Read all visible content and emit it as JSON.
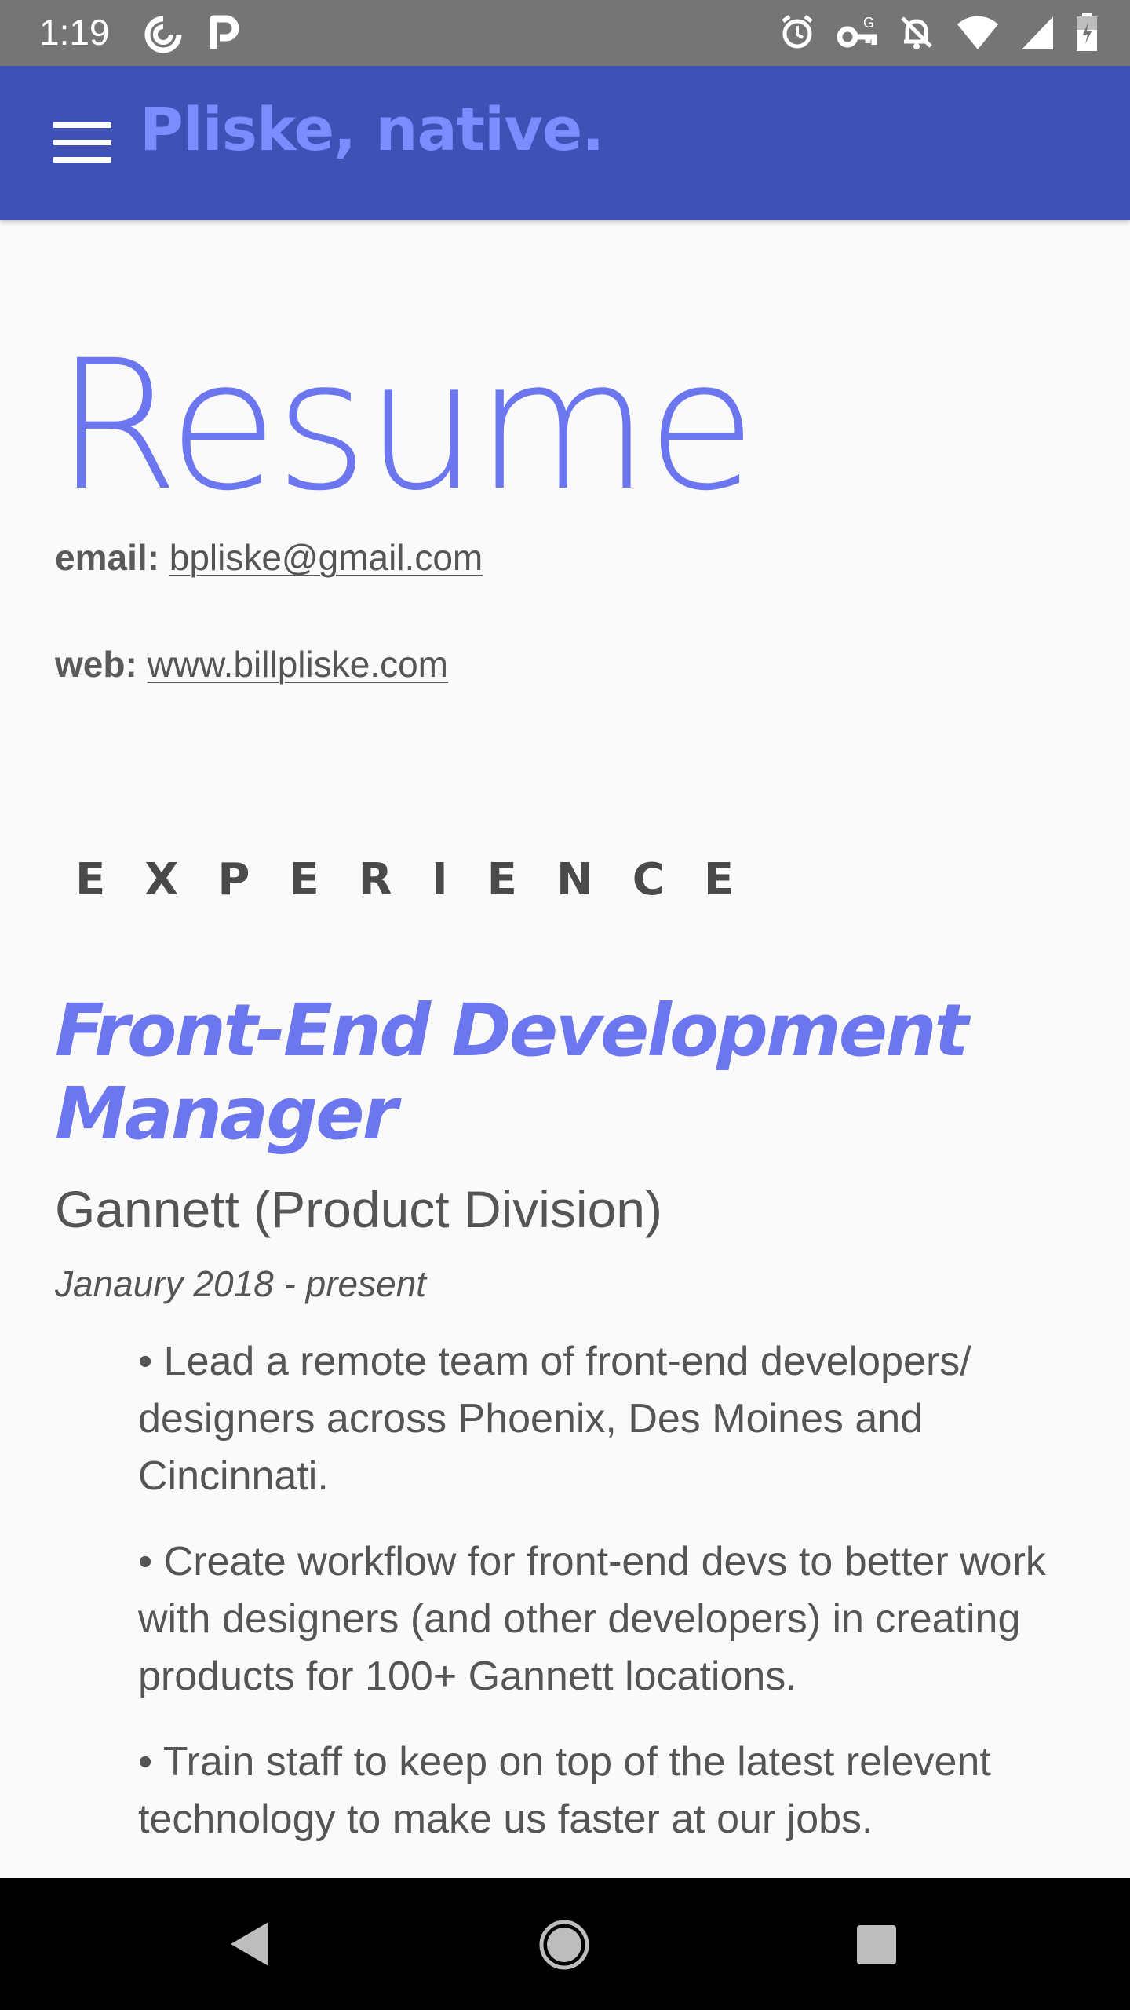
{
  "status_bar": {
    "time": "1:19",
    "left_icons": [
      "sync-icon",
      "parking-icon"
    ],
    "right_icons": [
      "alarm-icon",
      "vpn-key-icon",
      "notifications-off-icon",
      "wifi-icon",
      "signal-icon",
      "battery-icon"
    ]
  },
  "app_bar": {
    "title": "Pliske, native.",
    "menu_icon": "menu-icon",
    "background": "#3f51b5",
    "title_color": "#7a8cff"
  },
  "page": {
    "title": "Resume",
    "email_label": "email:",
    "email_value": "bpliske@gmail.com",
    "web_label": "web:",
    "web_value": "www.billpliske.com",
    "section_heading": "EXPERIENCE",
    "accent_color": "#6b76ef"
  },
  "jobs": [
    {
      "title": "Front-End Development Manager",
      "company": "Gannett (Product Division)",
      "dates": "Janaury 2018 - present",
      "bullets": [
        "• Lead a remote team of front-end developers/ designers across Phoenix, Des Moines and Cincinnati.",
        "• Create workflow for front-end devs to better work with designers (and other developers) in creating products for 100+ Gannett locations.",
        "• Train staff to keep on top of the latest relevent technology to make us faster at our jobs."
      ]
    }
  ],
  "nav_bar": {
    "buttons": [
      "back-icon",
      "home-icon",
      "recents-icon"
    ]
  }
}
